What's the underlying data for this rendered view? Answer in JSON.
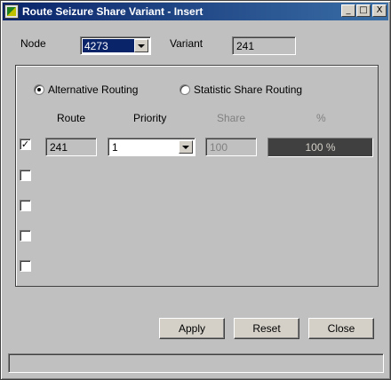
{
  "window": {
    "title": "Route Seizure Share Variant - Insert",
    "icon": "app-icon",
    "buttons": {
      "minimize": "_",
      "maximize": "□",
      "close": "X"
    }
  },
  "header": {
    "node_label": "Node",
    "node_value": "4273",
    "variant_label": "Variant",
    "variant_value": "241"
  },
  "routing": {
    "alternative_label": "Alternative Routing",
    "alternative_selected": true,
    "statistic_label": "Statistic Share Routing",
    "statistic_selected": false,
    "columns": {
      "route": "Route",
      "priority": "Priority",
      "share": "Share",
      "percent": "%"
    },
    "rows": [
      {
        "checked": true,
        "check_mark": "✓",
        "route": "241",
        "priority": "1",
        "share": "100",
        "percent_text": "100 %",
        "percent": 100
      },
      {
        "checked": false
      },
      {
        "checked": false
      },
      {
        "checked": false
      },
      {
        "checked": false
      }
    ]
  },
  "actions": {
    "apply": "Apply",
    "reset": "Reset",
    "close": "Close"
  },
  "status": {
    "text": ""
  }
}
